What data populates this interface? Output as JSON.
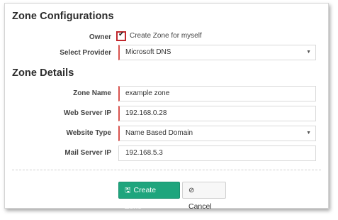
{
  "sections": {
    "configurations_title": "Zone Configurations",
    "details_title": "Zone Details"
  },
  "owner": {
    "label": "Owner",
    "checkbox_checked": true,
    "checkbox_text": "Create Zone for myself"
  },
  "provider": {
    "label": "Select Provider",
    "value": "Microsoft DNS"
  },
  "zone_name": {
    "label": "Zone Name",
    "value": "example zone"
  },
  "web_server_ip": {
    "label": "Web Server IP",
    "value": "192.168.0.28"
  },
  "website_type": {
    "label": "Website Type",
    "value": "Name Based Domain"
  },
  "mail_server_ip": {
    "label": "Mail Server IP",
    "value": "192.168.5.3"
  },
  "buttons": {
    "create": "Create Zone",
    "cancel": "Cancel"
  },
  "icons": {
    "save": "save-icon",
    "cancel": "cancel-icon",
    "check": "check-icon",
    "dropdown": "chevron-down-icon"
  },
  "colors": {
    "primary": "#1fa57d",
    "required_accent": "#d9534f",
    "checkbox_highlight": "#c0272d"
  }
}
